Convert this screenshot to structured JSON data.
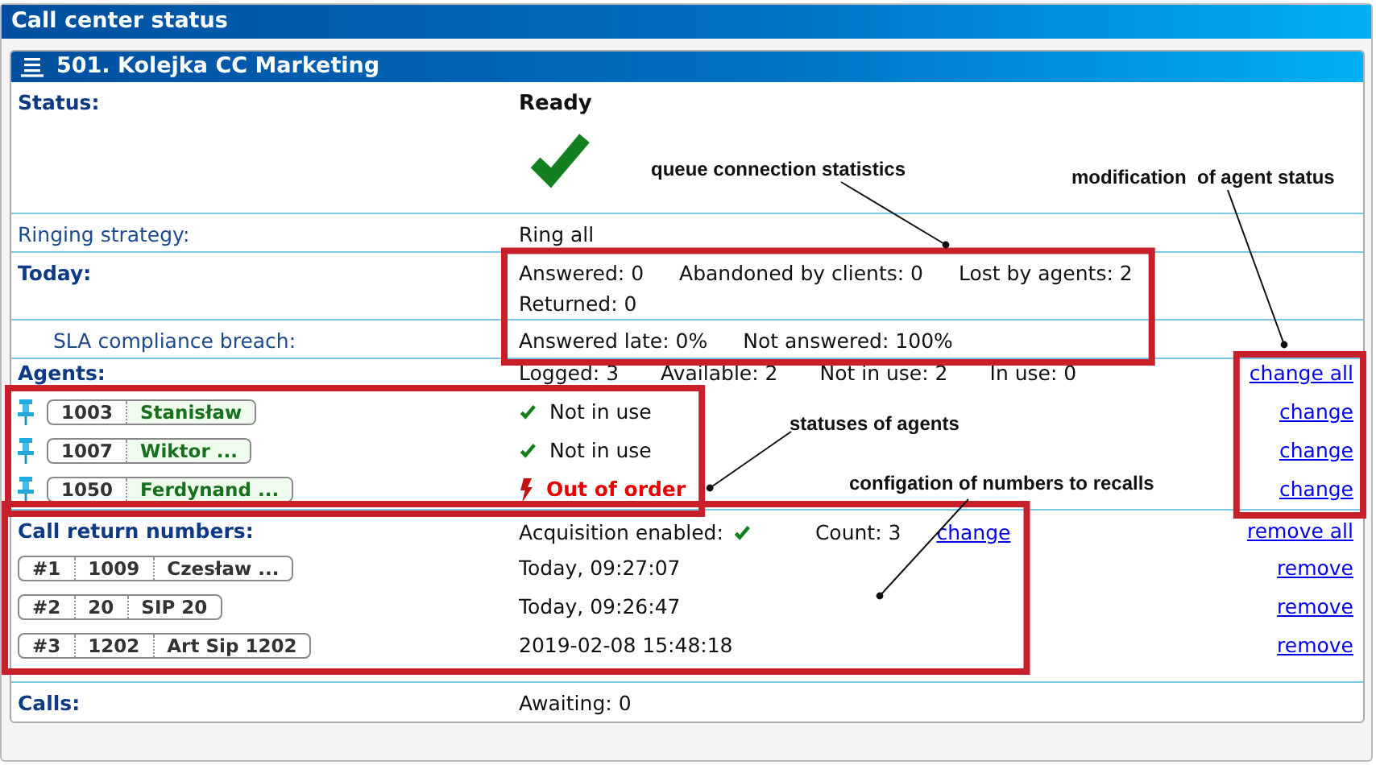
{
  "window": {
    "title": "Call center status"
  },
  "queue": {
    "title": "501. Kolejka CC Marketing"
  },
  "status": {
    "label": "Status:",
    "value": "Ready",
    "kind": "ready"
  },
  "ringing_strategy": {
    "label": "Ringing strategy:",
    "value": "Ring all"
  },
  "today": {
    "label": "Today:",
    "stats": [
      "Answered: 0",
      "Abandoned by clients: 0",
      "Lost by agents: 2",
      "Returned: 0"
    ]
  },
  "sla": {
    "label": "SLA compliance breach:",
    "stats": [
      "Answered late: 0%",
      "Not answered: 100%"
    ]
  },
  "agents": {
    "label": "Agents:",
    "stats": [
      "Logged: 3",
      "Available: 2",
      "Not in use: 2",
      "In use: 0"
    ],
    "action": "change all",
    "items": [
      {
        "pinned": true,
        "number": "1003",
        "name": "Stanisław",
        "kind": "ok",
        "status": "Not in use",
        "action": "change"
      },
      {
        "pinned": true,
        "number": "1007",
        "name": "Wiktor ...",
        "kind": "ok",
        "status": "Not in use",
        "action": "change"
      },
      {
        "pinned": true,
        "number": "1050",
        "name": "Ferdynand ...",
        "kind": "fault",
        "status": "Out of order",
        "action": "change"
      }
    ]
  },
  "call_return": {
    "label": "Call return numbers:",
    "acquisition_label": "Acquisition enabled:",
    "acquisition_enabled": true,
    "count": "Count: 3",
    "change": "change",
    "action": "remove all",
    "items": [
      {
        "position": "#1",
        "number": "1009",
        "name": "Czesław ...",
        "time": "Today, 09:27:07",
        "action": "remove"
      },
      {
        "position": "#2",
        "number": "20",
        "name": "SIP 20",
        "time": "Today, 09:26:47",
        "action": "remove"
      },
      {
        "position": "#3",
        "number": "1202",
        "name": "Art Sip 1202",
        "time": "2019-02-08 15:48:18",
        "action": "remove"
      }
    ]
  },
  "calls": {
    "label": "Calls:",
    "value": "Awaiting: 0"
  },
  "annotations": [
    {
      "text": "queue connection statistics"
    },
    {
      "text": "modification  of agent status"
    },
    {
      "text": "statuses of agents"
    },
    {
      "text": "configation of numbers to recalls"
    }
  ]
}
